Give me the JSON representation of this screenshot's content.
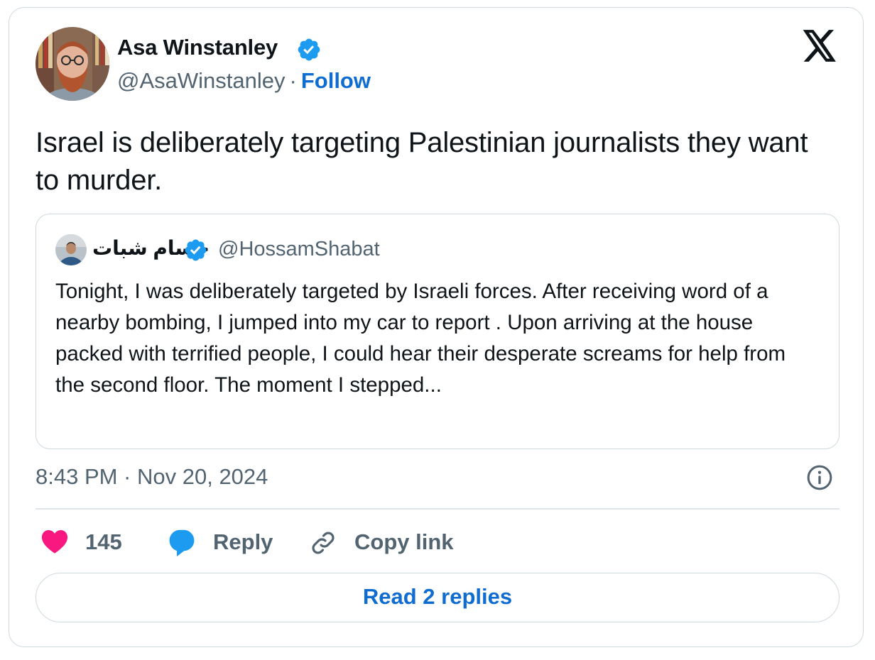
{
  "author": {
    "name": "Asa Winstanley",
    "handle": "@AsaWinstanley",
    "separator": "·",
    "follow_label": "Follow",
    "avatar_icon": "avatar-photo",
    "verified_icon": "verified-badge-icon"
  },
  "brand": {
    "logo_icon": "x-logo-icon"
  },
  "tweet": {
    "text": "Israel is deliberately targeting Palestinian journalists they want to murder."
  },
  "quote": {
    "name": "حسام شبات",
    "handle": "@HossamShabat",
    "text": "Tonight, I was deliberately targeted by Israeli forces. After receiving word of a nearby bombing, I jumped into my car to report . Upon arriving at the house packed with terrified people, I could hear their desperate screams for help from the second floor. The moment I stepped..."
  },
  "meta": {
    "timestamp": "8:43 PM · Nov 20, 2024"
  },
  "actions": {
    "like_count": "145",
    "reply_label": "Reply",
    "copy_link_label": "Copy link",
    "read_replies_label": "Read 2 replies"
  },
  "colors": {
    "like": "#f91880",
    "reply": "#1d9bf0",
    "link": "#0f6cd0",
    "verified": "#1d9bf0",
    "muted_text": "#536471",
    "border": "#cfd9de"
  }
}
